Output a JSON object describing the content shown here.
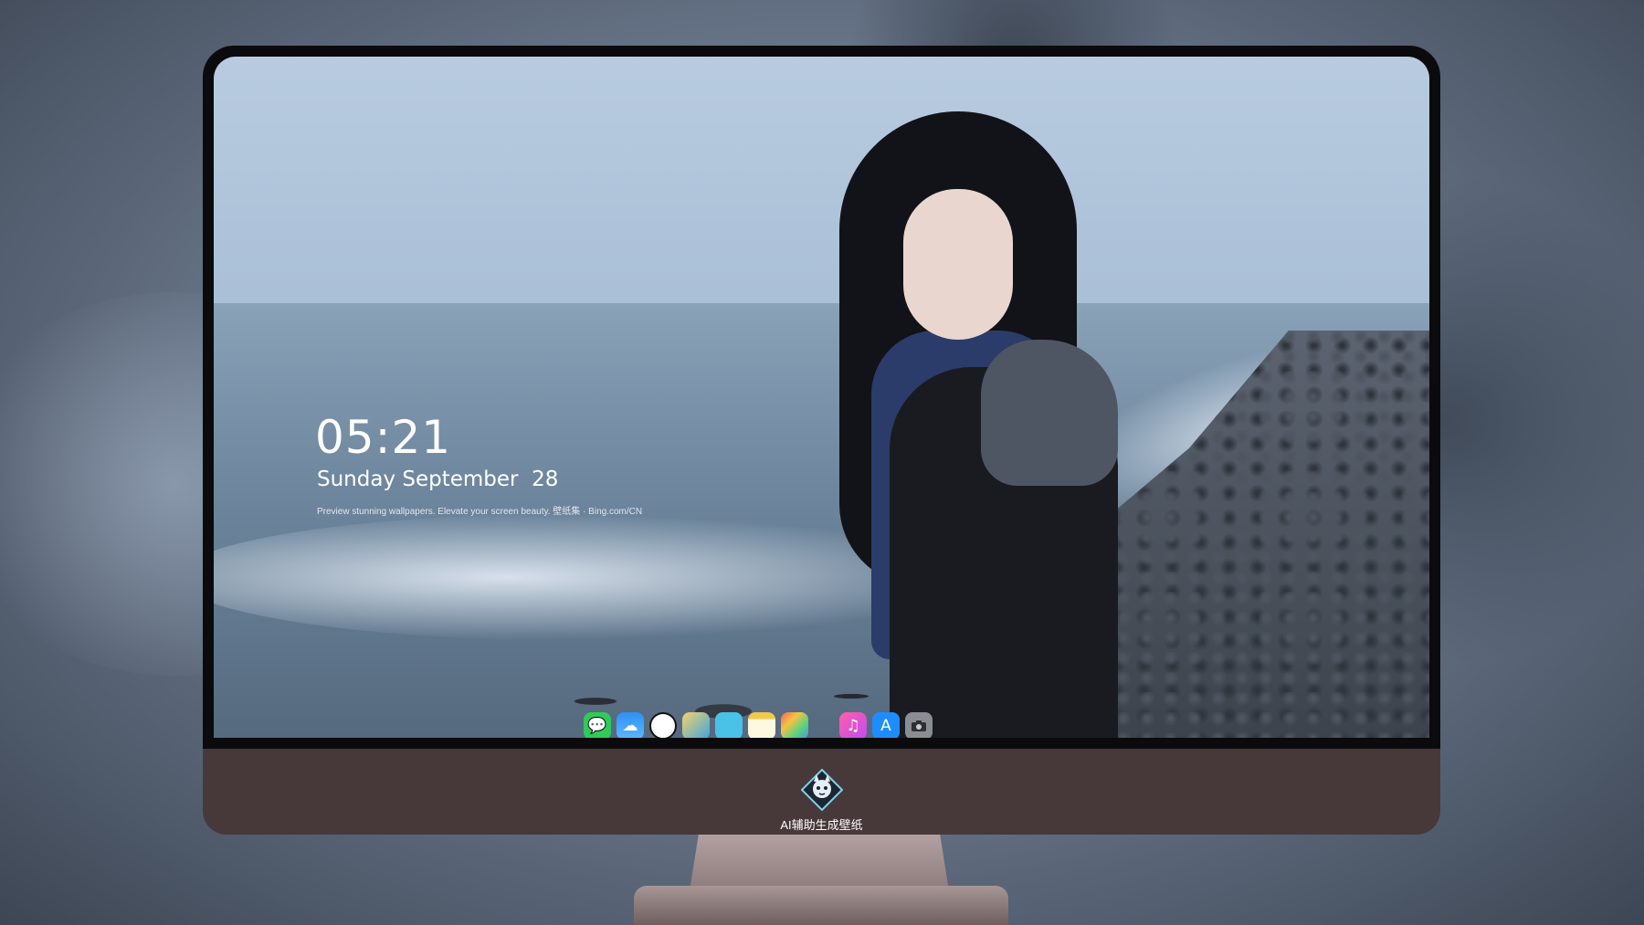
{
  "lockscreen": {
    "time": "05:21",
    "date": "Sunday September  28",
    "tagline": "Preview stunning wallpapers. Elevate your screen beauty. 壁纸集 · Bing.com/CN"
  },
  "dock": {
    "items": [
      {
        "name": "messages",
        "glyph": "💬"
      },
      {
        "name": "weather",
        "glyph": "☁"
      },
      {
        "name": "clock",
        "glyph": "🕔"
      },
      {
        "name": "preview",
        "glyph": "🖼"
      },
      {
        "name": "clips",
        "glyph": "🎬"
      },
      {
        "name": "notes",
        "glyph": ""
      },
      {
        "name": "photos",
        "glyph": "▦"
      },
      {
        "name": "music",
        "glyph": "♫"
      },
      {
        "name": "app-store",
        "glyph": "A"
      },
      {
        "name": "camera",
        "glyph": "📷"
      }
    ]
  },
  "chin": {
    "label": "AI辅助生成壁纸",
    "logo_icon": "cat-mascot-icon"
  },
  "colors": {
    "chin": "#473939",
    "bezel": "#0b0b0d",
    "stand": "#b5a3a3"
  }
}
